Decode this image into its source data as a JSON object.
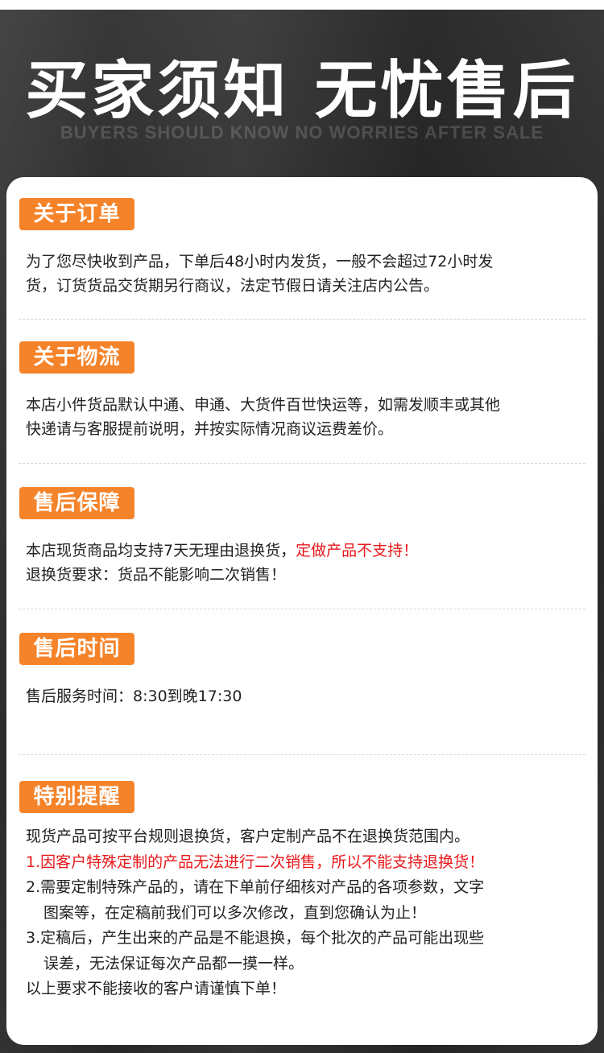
{
  "header": {
    "title": "买家须知 无忧售后",
    "subtitle": "BUYERS SHOULD KNOW NO WORRIES AFTER SALE"
  },
  "colors": {
    "accent": "#f5832a",
    "warning_text": "#e8181b",
    "body_text": "#222222",
    "card_bg": "#ffffff"
  },
  "sections": [
    {
      "label": "关于订单",
      "lines": [
        "为了您尽快收到产品，下单后48小时内发货，一般不会超过72小时发",
        "货，订货货品交货期另行商议，法定节假日请关注店内公告。"
      ]
    },
    {
      "label": "关于物流",
      "lines": [
        "本店小件货品默认中通、申通、大货件百世快运等，如需发顺丰或其他",
        "快递请与客服提前说明，并按实际情况商议运费差价。"
      ]
    },
    {
      "label": "售后保障",
      "line1_normal": "本店现货商品均支持7天无理由退换货，",
      "line1_red": "定做产品不支持！",
      "line2": "退换货要求：货品不能影响二次销售！"
    },
    {
      "label": "售后时间",
      "lines": [
        "售后服务时间：8:30到晚17:30"
      ]
    },
    {
      "label": "特别提醒",
      "intro": "现货产品可按平台规则退换货，客户定制产品不在退换货范围内。",
      "item1": "1.因客户特殊定制的产品无法进行二次销售，所以不能支持退换货！",
      "item2_a": "2.需要定制特殊产品的，请在下单前仔细核对产品的各项参数，文字",
      "item2_b": "图案等，在定稿前我们可以多次修改，直到您确认为止！",
      "item3_a": "3.定稿后，产生出来的产品是不能退换，每个批次的产品可能出现些",
      "item3_b": "误差，无法保证每次产品都一摸一样。",
      "outro": "以上要求不能接收的客户请谨慎下单！"
    }
  ]
}
